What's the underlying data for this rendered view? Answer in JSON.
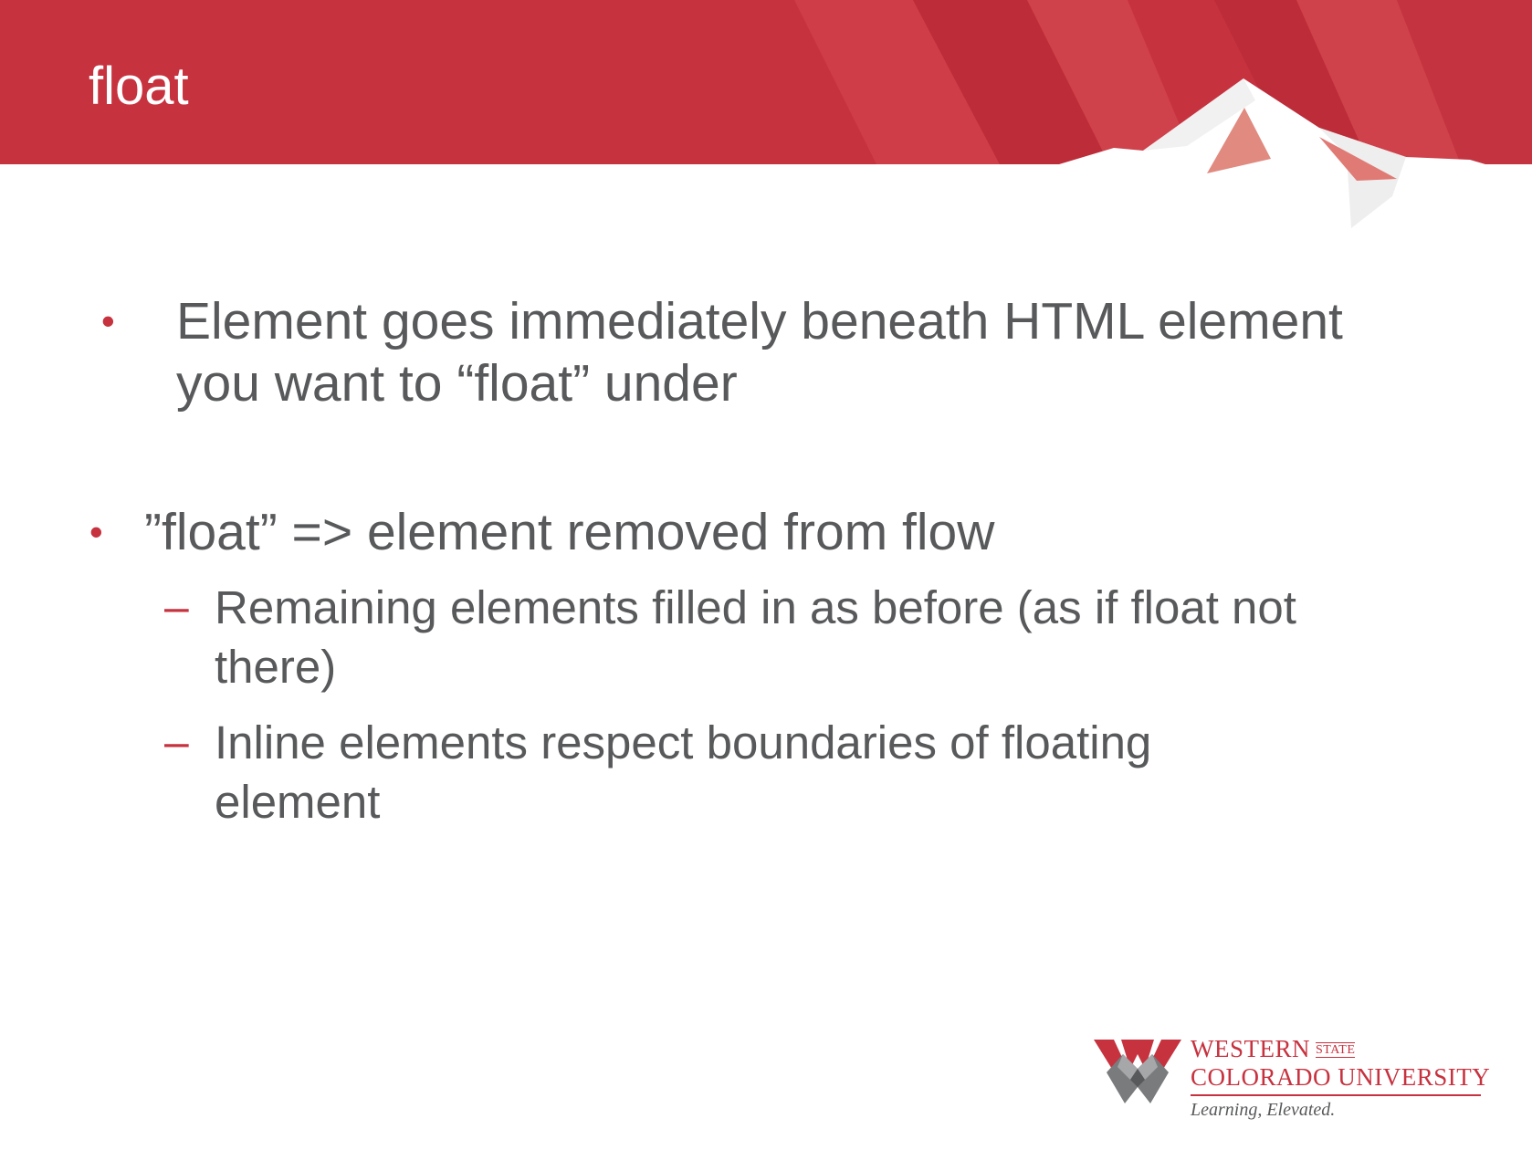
{
  "slide": {
    "title": "float",
    "bullets": [
      {
        "marker": "•",
        "lines": [
          "Element goes immediately beneath HTML element",
          "you want to “float” under"
        ]
      },
      {
        "marker": "•",
        "lines": [
          "”float” => element removed from flow"
        ],
        "sub": [
          {
            "marker": "–",
            "lines": [
              "Remaining elements filled in as before (as if float not",
              "there)"
            ]
          },
          {
            "marker": "–",
            "lines": [
              "Inline elements respect boundaries of floating",
              "element"
            ]
          }
        ]
      }
    ]
  },
  "logo": {
    "line1": "WESTERN",
    "state": "STATE",
    "line2": "COLORADO UNIVERSITY",
    "tagline": "Learning, Elevated."
  },
  "colors": {
    "header_red": "#c7323f",
    "accent_red": "#c7323f",
    "body_text": "#58595b",
    "title_text": "#ffffff"
  }
}
